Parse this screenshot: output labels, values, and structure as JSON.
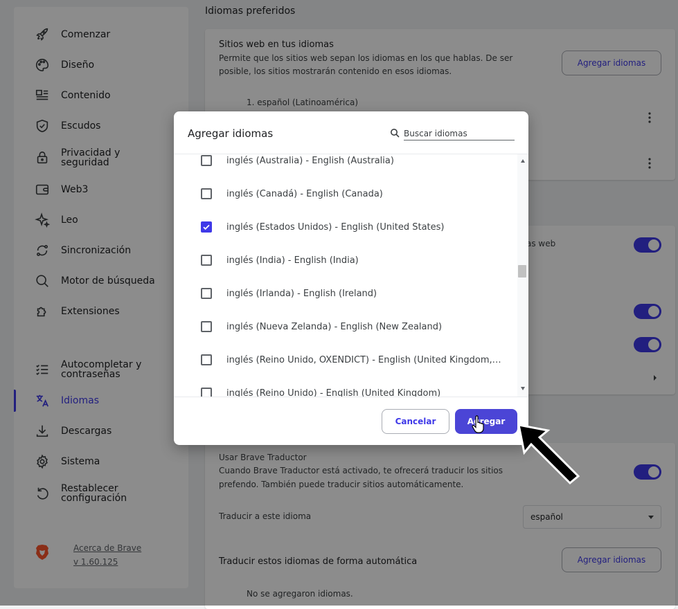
{
  "sidebar": {
    "items": [
      {
        "label": "Comenzar",
        "icon": "rocket-icon"
      },
      {
        "label": "Diseño",
        "icon": "palette-icon"
      },
      {
        "label": "Contenido",
        "icon": "content-icon"
      },
      {
        "label": "Escudos",
        "icon": "shield-icon"
      },
      {
        "label": "Privacidad y\nseguridad",
        "icon": "lock-icon"
      },
      {
        "label": "Web3",
        "icon": "wallet-icon"
      },
      {
        "label": "Leo",
        "icon": "sparkle-icon"
      },
      {
        "label": "Sincronización",
        "icon": "sync-icon"
      },
      {
        "label": "Motor de búsqueda",
        "icon": "search-icon"
      },
      {
        "label": "Extensiones",
        "icon": "puzzle-icon"
      },
      {
        "label": "Autocompletar y\ncontraseñas",
        "icon": "autofill-icon"
      },
      {
        "label": "Idiomas",
        "icon": "translate-icon",
        "active": true
      },
      {
        "label": "Descargas",
        "icon": "download-icon"
      },
      {
        "label": "Sistema",
        "icon": "gear-icon"
      },
      {
        "label": "Restablecer\nconfiguración",
        "icon": "reset-icon"
      }
    ],
    "about_line1": "Acerca de Brave",
    "about_line2": "v 1.60.125"
  },
  "content": {
    "section_title": "Idiomas preferidos",
    "sites_title": "Sitios web en tus idiomas",
    "sites_desc_1": "Permite que los sitios web sepan los idiomas en los que hablas. De ser",
    "sites_desc_2": "posible, los sitios mostrarán contenido en esos idiomas.",
    "add_languages_label": "Agregar idiomas",
    "lang_1": "1. español (Latinoamérica)",
    "spellcheck_partial": "as web",
    "translate_title": "Usar Brave Traductor",
    "translate_desc_1": "Cuando Brave Traductor está activado, te ofrecerá traducir los sitios",
    "translate_desc_2": "prefendo. También puede traducir sitios automáticamente.",
    "translate_to_label": "Traducir a este idioma",
    "translate_to_value": "español",
    "auto_translate_title": "Traducir estos idiomas de forma automática",
    "add_languages_label_2": "Agregar idiomas",
    "no_languages": "No se agregaron idiomas."
  },
  "dialog": {
    "title": "Agregar idiomas",
    "search_placeholder": "Buscar idiomas",
    "items": [
      {
        "label": "inglés (Australia) - English (Australia)",
        "checked": false
      },
      {
        "label": "inglés (Canadá) - English (Canada)",
        "checked": false
      },
      {
        "label": "inglés (Estados Unidos) - English (United States)",
        "checked": true
      },
      {
        "label": "inglés (India) - English (India)",
        "checked": false
      },
      {
        "label": "inglés (Irlanda) - English (Ireland)",
        "checked": false
      },
      {
        "label": "inglés (Nueva Zelanda) - English (New Zealand)",
        "checked": false
      },
      {
        "label": "inglés (Reino Unido, OXENDICT) - English (United Kingdom, OXENDICT)",
        "checked": false
      },
      {
        "label": "inglés (Reino Unido) - English (United Kingdom)",
        "checked": false
      }
    ],
    "cancel_label": "Cancelar",
    "add_label": "Agregar"
  },
  "colors": {
    "accent": "#3f39e8",
    "overlay": "rgba(0,0,0,0.45)"
  }
}
